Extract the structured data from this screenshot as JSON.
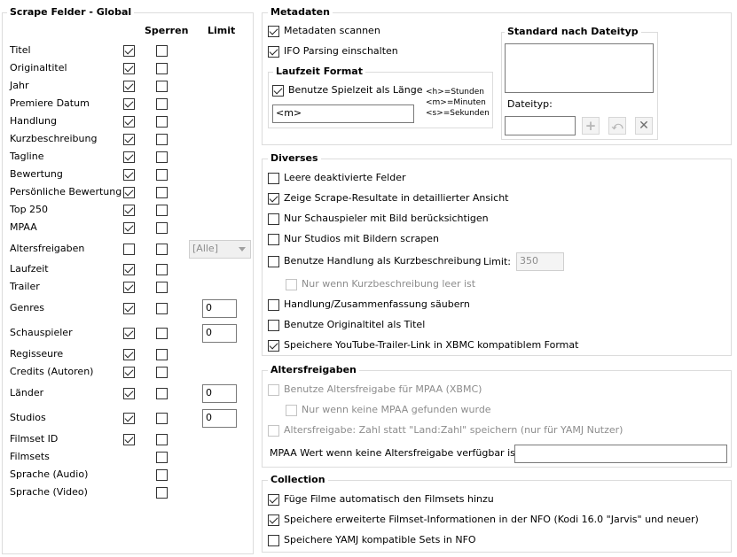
{
  "left": {
    "title": "Scrape Felder - Global",
    "col_sperren": "Sperren",
    "col_limit": "Limit",
    "rows": [
      {
        "label": "Titel",
        "scrape": true,
        "lock": false
      },
      {
        "label": "Originaltitel",
        "scrape": true,
        "lock": false
      },
      {
        "label": "Jahr",
        "scrape": true,
        "lock": false
      },
      {
        "label": "Premiere Datum",
        "scrape": true,
        "lock": false
      },
      {
        "label": "Handlung",
        "scrape": true,
        "lock": false
      },
      {
        "label": "Kurzbeschreibung",
        "scrape": true,
        "lock": false
      },
      {
        "label": "Tagline",
        "scrape": true,
        "lock": false
      },
      {
        "label": "Bewertung",
        "scrape": true,
        "lock": false
      },
      {
        "label": "Persönliche Bewertung",
        "scrape": true,
        "lock": false
      },
      {
        "label": "Top 250",
        "scrape": true,
        "lock": false
      },
      {
        "label": "MPAA",
        "scrape": true,
        "lock": false
      },
      {
        "label": "Altersfreigaben",
        "scrape": false,
        "lock": false,
        "dropdown": "[Alle]"
      },
      {
        "label": "Laufzeit",
        "scrape": true,
        "lock": false
      },
      {
        "label": "Trailer",
        "scrape": true,
        "lock": false
      },
      {
        "label": "Genres",
        "scrape": true,
        "lock": false,
        "limit": "0"
      },
      {
        "label": "Schauspieler",
        "scrape": true,
        "lock": false,
        "limit": "0"
      },
      {
        "label": "Regisseure",
        "scrape": true,
        "lock": false
      },
      {
        "label": "Credits (Autoren)",
        "scrape": true,
        "lock": false
      },
      {
        "label": "Länder",
        "scrape": true,
        "lock": false,
        "limit": "0"
      },
      {
        "label": "Studios",
        "scrape": true,
        "lock": false,
        "limit": "0"
      },
      {
        "label": "Filmset ID",
        "scrape": true,
        "lock": false
      },
      {
        "label": "Filmsets",
        "scrape": null,
        "lock": false
      },
      {
        "label": "Sprache (Audio)",
        "scrape": null,
        "lock": false
      },
      {
        "label": "Sprache (Video)",
        "scrape": null,
        "lock": false
      }
    ]
  },
  "metadaten": {
    "title": "Metadaten",
    "scan_label": "Metadaten scannen",
    "scan": true,
    "ifo_label": "IFO Parsing einschalten",
    "ifo": true,
    "laufzeit_title": "Laufzeit Format",
    "spielzeit_label": "Benutze Spielzeit als Länge",
    "spielzeit": true,
    "format_value": "<m>",
    "legend": [
      "<h>=Stunden",
      "<m>=Minuten",
      "<s>=Sekunden"
    ],
    "standard_title": "Standard nach Dateityp",
    "dateityp_label": "Dateityp:",
    "dateityp_value": "",
    "add_icon": "+",
    "edit_icon": "⤺",
    "remove_icon": "✕"
  },
  "diverses": {
    "title": "Diverses",
    "items": [
      {
        "label": "Leere deaktivierte Felder",
        "checked": false
      },
      {
        "label": "Zeige Scrape-Resultate in detaillierter Ansicht",
        "checked": true
      },
      {
        "label": "Nur Schauspieler mit Bild berücksichtigen",
        "checked": false
      },
      {
        "label": "Nur Studios mit Bildern scrapen",
        "checked": false
      },
      {
        "label": "Benutze Handlung als Kurzbeschreibung",
        "checked": false
      },
      {
        "label": "Nur wenn Kurzbeschreibung leer ist",
        "checked": false,
        "disabled": true
      },
      {
        "label": "Handlung/Zusammenfassung säubern",
        "checked": false
      },
      {
        "label": "Benutze Originaltitel als Titel",
        "checked": false
      },
      {
        "label": "Speichere YouTube-Trailer-Link in XBMC kompatiblem Format",
        "checked": true
      }
    ],
    "limit_label": "Limit:",
    "limit_value": "350"
  },
  "altersfreigaben": {
    "title": "Altersfreigaben",
    "items": [
      {
        "label": "Benutze Altersfreigabe für MPAA (XBMC)",
        "checked": false,
        "disabled": true
      },
      {
        "label": "Nur wenn keine MPAA gefunden wurde",
        "checked": false,
        "disabled": true
      },
      {
        "label": "Altersfreigabe: Zahl statt \"Land:Zahl\" speichern (nur für YAMJ Nutzer)",
        "checked": false,
        "disabled": true
      }
    ],
    "mpaa_label": "MPAA Wert wenn keine Altersfreigabe verfügbar ist:",
    "mpaa_value": ""
  },
  "collection": {
    "title": "Collection",
    "items": [
      {
        "label": "Füge Filme automatisch den Filmsets hinzu",
        "checked": true
      },
      {
        "label": "Speichere erweiterte Filmset-Informationen in der NFO (Kodi 16.0 \"Jarvis\" und neuer)",
        "checked": true
      },
      {
        "label": "Speichere YAMJ kompatible Sets in NFO",
        "checked": false
      }
    ]
  }
}
